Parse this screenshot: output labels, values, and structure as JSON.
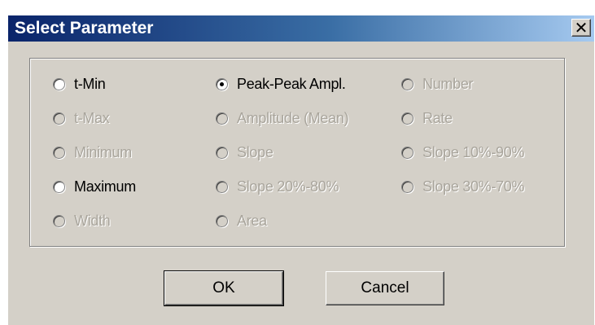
{
  "window": {
    "title": "Select Parameter",
    "close_glyph": "✕"
  },
  "options": {
    "t_min": {
      "label": "t-Min",
      "checked": false,
      "enabled": true
    },
    "t_max": {
      "label": "t-Max",
      "checked": false,
      "enabled": false
    },
    "minimum": {
      "label": "Minimum",
      "checked": false,
      "enabled": false
    },
    "maximum": {
      "label": "Maximum",
      "checked": false,
      "enabled": true
    },
    "width": {
      "label": "Width",
      "checked": false,
      "enabled": false
    },
    "peak_peak": {
      "label": "Peak-Peak Ampl.",
      "checked": true,
      "enabled": true
    },
    "amplitude_mean": {
      "label": "Amplitude (Mean)",
      "checked": false,
      "enabled": false
    },
    "slope": {
      "label": "Slope",
      "checked": false,
      "enabled": false
    },
    "slope_20_80": {
      "label": "Slope 20%-80%",
      "checked": false,
      "enabled": false
    },
    "area": {
      "label": "Area",
      "checked": false,
      "enabled": false
    },
    "number": {
      "label": "Number",
      "checked": false,
      "enabled": false
    },
    "rate": {
      "label": "Rate",
      "checked": false,
      "enabled": false
    },
    "slope_10_90": {
      "label": "Slope 10%-90%",
      "checked": false,
      "enabled": false
    },
    "slope_30_70": {
      "label": "Slope 30%-70%",
      "checked": false,
      "enabled": false
    }
  },
  "buttons": {
    "ok": "OK",
    "cancel": "Cancel"
  },
  "colors": {
    "dialog_face": "#d4d0c8",
    "title_start": "#0a246a",
    "title_end": "#a6caf0",
    "disabled_text": "#a9a59c"
  }
}
